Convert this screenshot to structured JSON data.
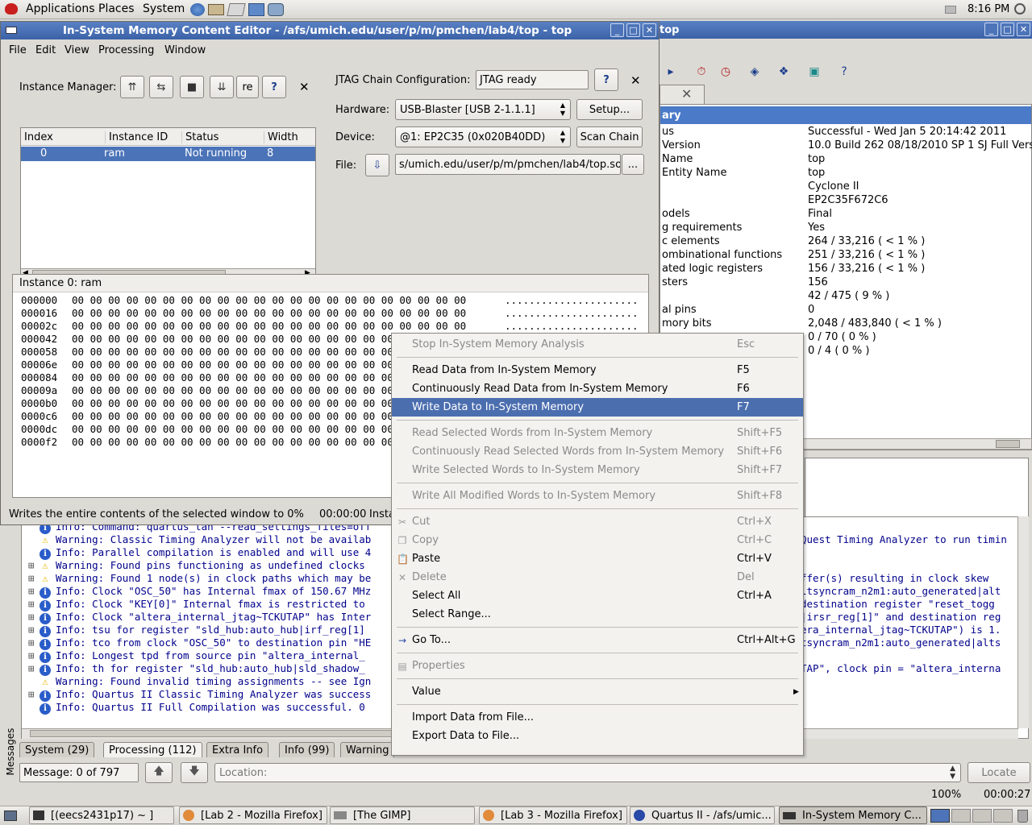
{
  "top_panel": {
    "menus": [
      "Applications",
      "Places",
      "System"
    ],
    "clock": "8:16 PM"
  },
  "editor_window": {
    "title": "In-System Memory Content Editor - /afs/umich.edu/user/p/m/pmchen/lab4/top - top",
    "menubar": [
      "File",
      "Edit",
      "View",
      "Processing",
      "Window"
    ],
    "instance_manager": {
      "label": "Instance Manager:",
      "tool_label": "re",
      "columns": [
        "Index",
        "Instance ID",
        "Status",
        "Width"
      ],
      "rows": [
        {
          "index": "0",
          "instance_id": "ram",
          "status": "Not running",
          "width": "8"
        }
      ]
    },
    "jtag": {
      "label": "JTAG Chain Configuration:",
      "status": "JTAG ready",
      "hardware_label": "Hardware:",
      "hardware_value": "USB-Blaster [USB 2-1.1.1]",
      "setup_button": "Setup...",
      "device_label": "Device:",
      "device_value": "@1: EP2C35 (0x020B40DD)",
      "scan_button": "Scan Chain",
      "file_label": "File:",
      "file_value": "s/umich.edu/user/p/m/pmchen/lab4/top.sof",
      "browse_button": "..."
    },
    "instance_panel": {
      "header": "Instance 0: ram",
      "rows": [
        {
          "addr": "000000",
          "bytes": "00 00 00 00 00 00 00 00 00 00 00 00 00 00 00 00 00 00 00 00 00 00",
          "ascii": "......................"
        },
        {
          "addr": "000016",
          "bytes": "00 00 00 00 00 00 00 00 00 00 00 00 00 00 00 00 00 00 00 00 00 00",
          "ascii": "......................"
        },
        {
          "addr": "00002c",
          "bytes": "00 00 00 00 00 00 00 00 00 00 00 00 00 00 00 00 00 00 00 00 00 00",
          "ascii": "......................"
        },
        {
          "addr": "000042",
          "bytes": "00 00 00 00 00 00 00 00 00 00 00 00 00 00 00 00 00 00 00 00 00 00",
          "ascii": ""
        },
        {
          "addr": "000058",
          "bytes": "00 00 00 00 00 00 00 00 00 00 00 00 00 00 00 00 00 00 00 00 00 00",
          "ascii": ""
        },
        {
          "addr": "00006e",
          "bytes": "00 00 00 00 00 00 00 00 00 00 00 00 00 00 00 00 00 00 00 00 00 00",
          "ascii": ""
        },
        {
          "addr": "000084",
          "bytes": "00 00 00 00 00 00 00 00 00 00 00 00 00 00 00 00 00 00 00 00 00 00",
          "ascii": ""
        },
        {
          "addr": "00009a",
          "bytes": "00 00 00 00 00 00 00 00 00 00 00 00 00 00 00 00 00 00 00 00 00 00",
          "ascii": ""
        },
        {
          "addr": "0000b0",
          "bytes": "00 00 00 00 00 00 00 00 00 00 00 00 00 00 00 00 00 00 00 00 00 00",
          "ascii": ""
        },
        {
          "addr": "0000c6",
          "bytes": "00 00 00 00 00 00 00 00 00 00 00 00 00 00 00 00 00 00 00 00 00 00",
          "ascii": ""
        },
        {
          "addr": "0000dc",
          "bytes": "00 00 00 00 00 00 00 00 00 00 00 00 00 00 00 00 00 00 00 00 00 00",
          "ascii": ""
        },
        {
          "addr": "0000f2",
          "bytes": "00 00 00 00 00 00 00 00 00 00 00 00 00 00 00 00 00 00 00 00 00 00",
          "ascii": ""
        }
      ]
    },
    "status_bar": {
      "text": "Writes the entire contents of the selected window to 0%",
      "time": "00:00:00",
      "extra": "Insta"
    }
  },
  "quartus_window": {
    "title": "top",
    "summary_header": "ary",
    "summary": [
      {
        "label": "us",
        "value": "Successful - Wed Jan  5 20:14:42 2011"
      },
      {
        "label": "Version",
        "value": "10.0 Build 262 08/18/2010 SP 1 SJ Full Versi"
      },
      {
        "label": "Name",
        "value": "top"
      },
      {
        "label": "Entity Name",
        "value": "top"
      },
      {
        "label": "",
        "value": "Cyclone II"
      },
      {
        "label": "",
        "value": "EP2C35F672C6"
      },
      {
        "label": "odels",
        "value": "Final"
      },
      {
        "label": "g requirements",
        "value": "Yes"
      },
      {
        "label": "c elements",
        "value": "264 / 33,216 ( < 1 % )"
      },
      {
        "label": "ombinational functions",
        "value": "251 / 33,216 ( < 1 % )"
      },
      {
        "label": "ated logic registers",
        "value": "156 / 33,216 ( < 1 % )"
      },
      {
        "label": "sters",
        "value": "156"
      },
      {
        "label": "",
        "value": "42 / 475 ( 9 % )"
      },
      {
        "label": "al pins",
        "value": "0"
      },
      {
        "label": "mory bits",
        "value": "2,048 / 483,840 ( < 1 % )"
      },
      {
        "label": "",
        "value": "0 / 70 ( 0 % )"
      },
      {
        "label": "",
        "value": "0 / 4 ( 0 % )"
      }
    ],
    "messages_side_label": "Messages",
    "messages": [
      {
        "type": "info",
        "expand": false,
        "left": "Info: Command: quartus_tan --read_settings_files=off",
        "right": ""
      },
      {
        "type": "warning",
        "expand": false,
        "left": "Warning: Classic Timing Analyzer will not be availab",
        "right": "Quest Timing Analyzer to run timin"
      },
      {
        "type": "info",
        "expand": false,
        "left": "Info: Parallel compilation is enabled and will use 4",
        "right": ""
      },
      {
        "type": "warning",
        "expand": true,
        "left": "Warning: Found pins functioning as undefined clocks",
        "right": ""
      },
      {
        "type": "warning",
        "expand": true,
        "left": "Warning: Found 1 node(s) in clock paths which may be",
        "right": "ffer(s) resulting in clock skew"
      },
      {
        "type": "info",
        "expand": true,
        "left": "Info: Clock \"OSC_50\" has Internal fmax of 150.67 MHz",
        "right": "ltsyncram_n2m1:auto_generated|alt"
      },
      {
        "type": "info",
        "expand": true,
        "left": "Info: Clock \"KEY[0]\" Internal fmax is restricted to",
        "right": "destination register \"reset_togg"
      },
      {
        "type": "info",
        "expand": true,
        "left": "Info: Clock \"altera_internal_jtag~TCKUTAP\" has Inter",
        "right": "|irsr_reg[1]\" and destination reg"
      },
      {
        "type": "info",
        "expand": true,
        "left": "Info: tsu for register \"sld_hub:auto_hub|irf_reg[1]",
        "right": "era_internal_jtag~TCKUTAP\") is 1."
      },
      {
        "type": "info",
        "expand": true,
        "left": "Info: tco from clock \"OSC_50\" to destination pin \"HE",
        "right": "tsyncram_n2m1:auto_generated|alts"
      },
      {
        "type": "info",
        "expand": true,
        "left": "Info: Longest tpd from source pin \"altera_internal_",
        "right": ""
      },
      {
        "type": "info",
        "expand": true,
        "left": "Info: th for register \"sld_hub:auto_hub|sld_shadow_",
        "right": "TAP\", clock pin = \"altera_interna"
      },
      {
        "type": "warning",
        "expand": false,
        "left": "Warning: Found invalid timing assignments -- see Ign",
        "right": ""
      },
      {
        "type": "info",
        "expand": true,
        "left": "Info: Quartus II Classic Timing Analyzer was success",
        "right": ""
      },
      {
        "type": "info",
        "expand": false,
        "left": "Info: Quartus II Full Compilation was successful. 0",
        "right": ""
      }
    ],
    "tabs": [
      "System (29)",
      "Processing (112)",
      "Extra Info",
      "Info (99)",
      "Warning"
    ],
    "message_count": "Message: 0 of 797",
    "location_placeholder": "Location:",
    "locate_button": "Locate",
    "zoom": "100%",
    "elapsed": "00:00:27"
  },
  "context_menu": {
    "items": [
      {
        "label": "Stop In-System Memory Analysis",
        "key": "Esc",
        "disabled": true,
        "icon": ""
      },
      {
        "sep": true
      },
      {
        "label": "Read Data from In-System Memory",
        "key": "F5",
        "disabled": false,
        "icon": ""
      },
      {
        "label": "Continuously Read Data from In-System Memory",
        "key": "F6",
        "disabled": false,
        "icon": ""
      },
      {
        "label": "Write Data to In-System Memory",
        "key": "F7",
        "disabled": false,
        "selected": true,
        "icon": ""
      },
      {
        "sep": true
      },
      {
        "label": "Read Selected Words from In-System Memory",
        "key": "Shift+F5",
        "disabled": true,
        "icon": ""
      },
      {
        "label": "Continuously Read Selected Words from In-System Memory",
        "key": "Shift+F6",
        "disabled": true,
        "icon": ""
      },
      {
        "label": "Write Selected Words to In-System Memory",
        "key": "Shift+F7",
        "disabled": true,
        "icon": ""
      },
      {
        "sep": true
      },
      {
        "label": "Write All Modified Words to In-System Memory",
        "key": "Shift+F8",
        "disabled": true,
        "icon": ""
      },
      {
        "sep": true
      },
      {
        "label": "Cut",
        "key": "Ctrl+X",
        "disabled": true,
        "icon": "scissors-icon"
      },
      {
        "label": "Copy",
        "key": "Ctrl+C",
        "disabled": true,
        "icon": "copy-icon"
      },
      {
        "label": "Paste",
        "key": "Ctrl+V",
        "disabled": false,
        "icon": "paste-icon"
      },
      {
        "label": "Delete",
        "key": "Del",
        "disabled": true,
        "icon": "delete-icon"
      },
      {
        "label": "Select All",
        "key": "Ctrl+A",
        "disabled": false,
        "icon": ""
      },
      {
        "label": "Select Range...",
        "key": "",
        "disabled": false,
        "icon": ""
      },
      {
        "sep": true
      },
      {
        "label": "Go To...",
        "key": "Ctrl+Alt+G",
        "disabled": false,
        "icon": "arrow-right-icon"
      },
      {
        "sep": true
      },
      {
        "label": "Properties",
        "key": "",
        "disabled": true,
        "icon": "properties-icon"
      },
      {
        "sep": true
      },
      {
        "label": "Value",
        "key": "",
        "disabled": false,
        "submenu": true,
        "icon": ""
      },
      {
        "sep": true
      },
      {
        "label": "Import Data from File...",
        "key": "",
        "disabled": false,
        "icon": ""
      },
      {
        "label": "Export Data to File...",
        "key": "",
        "disabled": false,
        "icon": ""
      }
    ]
  },
  "taskbar": {
    "items": [
      "[(eecs2431p17)  ~  ]",
      "[Lab 2 - Mozilla Firefox]",
      "[The GIMP]",
      "[Lab 3 - Mozilla Firefox]",
      "Quartus II - /afs/umic...",
      "In-System Memory C..."
    ]
  }
}
